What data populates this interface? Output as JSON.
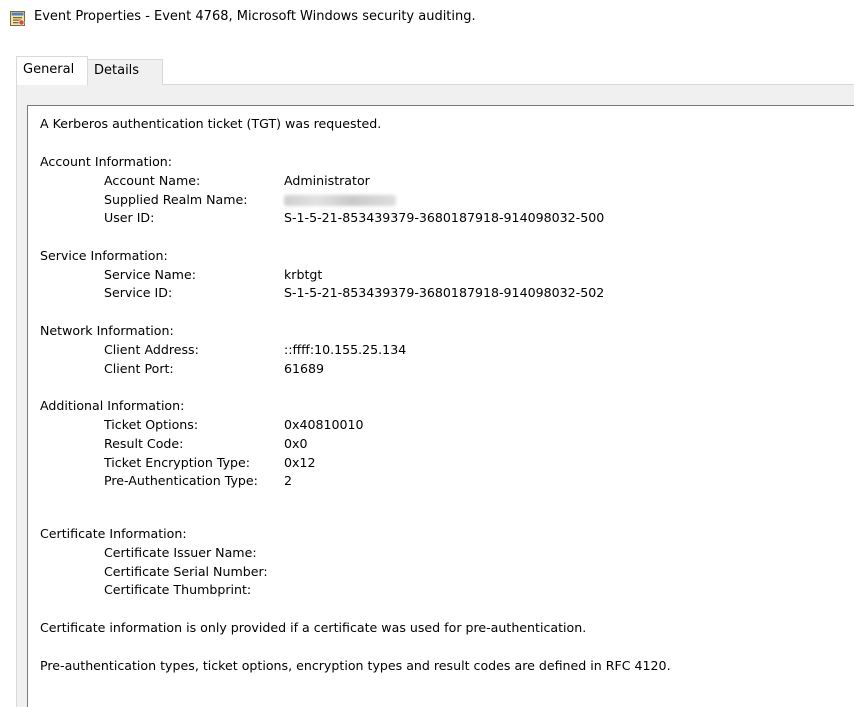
{
  "window": {
    "title": "Event Properties - Event 4768, Microsoft Windows security auditing.",
    "icon": "event-viewer-icon"
  },
  "tabs": [
    {
      "label": "General",
      "selected": true
    },
    {
      "label": "Details",
      "selected": false
    }
  ],
  "event": {
    "summary": "A Kerberos authentication ticket (TGT) was requested.",
    "account": {
      "header": "Account Information:",
      "account_name_label": "Account Name:",
      "account_name_value": "Administrator",
      "supplied_realm_label": "Supplied Realm Name:",
      "user_id_label": "User ID:",
      "user_id_value": "S-1-5-21-853439379-3680187918-914098032-500"
    },
    "service": {
      "header": "Service Information:",
      "service_name_label": "Service Name:",
      "service_name_value": "krbtgt",
      "service_id_label": "Service ID:",
      "service_id_value": "S-1-5-21-853439379-3680187918-914098032-502"
    },
    "network": {
      "header": "Network Information:",
      "client_address_label": "Client Address:",
      "client_address_value": "::ffff:10.155.25.134",
      "client_port_label": "Client Port:",
      "client_port_value": "61689"
    },
    "additional": {
      "header": "Additional Information:",
      "ticket_options_label": "Ticket Options:",
      "ticket_options_value": "0x40810010",
      "result_code_label": "Result Code:",
      "result_code_value": "0x0",
      "ticket_encryption_label": "Ticket Encryption Type:",
      "ticket_encryption_value": "0x12",
      "pre_auth_label": "Pre-Authentication Type:",
      "pre_auth_value": "2"
    },
    "certificate": {
      "header": "Certificate Information:",
      "issuer_label": "Certificate Issuer Name:",
      "serial_label": "Certificate Serial Number:",
      "thumbprint_label": "Certificate Thumbprint:"
    },
    "note1": "Certificate information is only provided if a certificate was used for pre-authentication.",
    "note2": "Pre-authentication types, ticket options, encryption types and result codes are defined in RFC 4120."
  }
}
